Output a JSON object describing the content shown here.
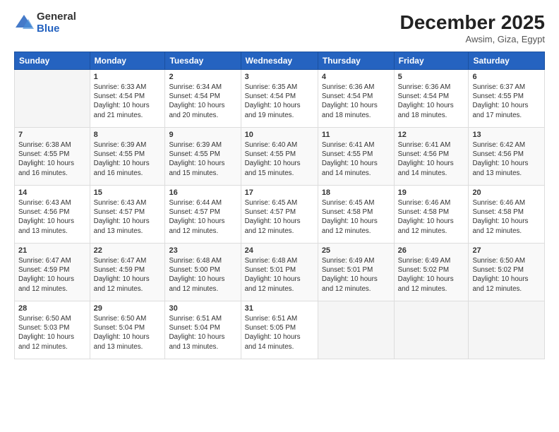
{
  "logo": {
    "general": "General",
    "blue": "Blue"
  },
  "header": {
    "month_year": "December 2025",
    "location": "Awsim, Giza, Egypt"
  },
  "days_of_week": [
    "Sunday",
    "Monday",
    "Tuesday",
    "Wednesday",
    "Thursday",
    "Friday",
    "Saturday"
  ],
  "weeks": [
    [
      {
        "day": "",
        "info": ""
      },
      {
        "day": "1",
        "info": "Sunrise: 6:33 AM\nSunset: 4:54 PM\nDaylight: 10 hours\nand 21 minutes."
      },
      {
        "day": "2",
        "info": "Sunrise: 6:34 AM\nSunset: 4:54 PM\nDaylight: 10 hours\nand 20 minutes."
      },
      {
        "day": "3",
        "info": "Sunrise: 6:35 AM\nSunset: 4:54 PM\nDaylight: 10 hours\nand 19 minutes."
      },
      {
        "day": "4",
        "info": "Sunrise: 6:36 AM\nSunset: 4:54 PM\nDaylight: 10 hours\nand 18 minutes."
      },
      {
        "day": "5",
        "info": "Sunrise: 6:36 AM\nSunset: 4:54 PM\nDaylight: 10 hours\nand 18 minutes."
      },
      {
        "day": "6",
        "info": "Sunrise: 6:37 AM\nSunset: 4:55 PM\nDaylight: 10 hours\nand 17 minutes."
      }
    ],
    [
      {
        "day": "7",
        "info": "Sunrise: 6:38 AM\nSunset: 4:55 PM\nDaylight: 10 hours\nand 16 minutes."
      },
      {
        "day": "8",
        "info": "Sunrise: 6:39 AM\nSunset: 4:55 PM\nDaylight: 10 hours\nand 16 minutes."
      },
      {
        "day": "9",
        "info": "Sunrise: 6:39 AM\nSunset: 4:55 PM\nDaylight: 10 hours\nand 15 minutes."
      },
      {
        "day": "10",
        "info": "Sunrise: 6:40 AM\nSunset: 4:55 PM\nDaylight: 10 hours\nand 15 minutes."
      },
      {
        "day": "11",
        "info": "Sunrise: 6:41 AM\nSunset: 4:55 PM\nDaylight: 10 hours\nand 14 minutes."
      },
      {
        "day": "12",
        "info": "Sunrise: 6:41 AM\nSunset: 4:56 PM\nDaylight: 10 hours\nand 14 minutes."
      },
      {
        "day": "13",
        "info": "Sunrise: 6:42 AM\nSunset: 4:56 PM\nDaylight: 10 hours\nand 13 minutes."
      }
    ],
    [
      {
        "day": "14",
        "info": "Sunrise: 6:43 AM\nSunset: 4:56 PM\nDaylight: 10 hours\nand 13 minutes."
      },
      {
        "day": "15",
        "info": "Sunrise: 6:43 AM\nSunset: 4:57 PM\nDaylight: 10 hours\nand 13 minutes."
      },
      {
        "day": "16",
        "info": "Sunrise: 6:44 AM\nSunset: 4:57 PM\nDaylight: 10 hours\nand 12 minutes."
      },
      {
        "day": "17",
        "info": "Sunrise: 6:45 AM\nSunset: 4:57 PM\nDaylight: 10 hours\nand 12 minutes."
      },
      {
        "day": "18",
        "info": "Sunrise: 6:45 AM\nSunset: 4:58 PM\nDaylight: 10 hours\nand 12 minutes."
      },
      {
        "day": "19",
        "info": "Sunrise: 6:46 AM\nSunset: 4:58 PM\nDaylight: 10 hours\nand 12 minutes."
      },
      {
        "day": "20",
        "info": "Sunrise: 6:46 AM\nSunset: 4:58 PM\nDaylight: 10 hours\nand 12 minutes."
      }
    ],
    [
      {
        "day": "21",
        "info": "Sunrise: 6:47 AM\nSunset: 4:59 PM\nDaylight: 10 hours\nand 12 minutes."
      },
      {
        "day": "22",
        "info": "Sunrise: 6:47 AM\nSunset: 4:59 PM\nDaylight: 10 hours\nand 12 minutes."
      },
      {
        "day": "23",
        "info": "Sunrise: 6:48 AM\nSunset: 5:00 PM\nDaylight: 10 hours\nand 12 minutes."
      },
      {
        "day": "24",
        "info": "Sunrise: 6:48 AM\nSunset: 5:01 PM\nDaylight: 10 hours\nand 12 minutes."
      },
      {
        "day": "25",
        "info": "Sunrise: 6:49 AM\nSunset: 5:01 PM\nDaylight: 10 hours\nand 12 minutes."
      },
      {
        "day": "26",
        "info": "Sunrise: 6:49 AM\nSunset: 5:02 PM\nDaylight: 10 hours\nand 12 minutes."
      },
      {
        "day": "27",
        "info": "Sunrise: 6:50 AM\nSunset: 5:02 PM\nDaylight: 10 hours\nand 12 minutes."
      }
    ],
    [
      {
        "day": "28",
        "info": "Sunrise: 6:50 AM\nSunset: 5:03 PM\nDaylight: 10 hours\nand 12 minutes."
      },
      {
        "day": "29",
        "info": "Sunrise: 6:50 AM\nSunset: 5:04 PM\nDaylight: 10 hours\nand 13 minutes."
      },
      {
        "day": "30",
        "info": "Sunrise: 6:51 AM\nSunset: 5:04 PM\nDaylight: 10 hours\nand 13 minutes."
      },
      {
        "day": "31",
        "info": "Sunrise: 6:51 AM\nSunset: 5:05 PM\nDaylight: 10 hours\nand 14 minutes."
      },
      {
        "day": "",
        "info": ""
      },
      {
        "day": "",
        "info": ""
      },
      {
        "day": "",
        "info": ""
      }
    ]
  ]
}
